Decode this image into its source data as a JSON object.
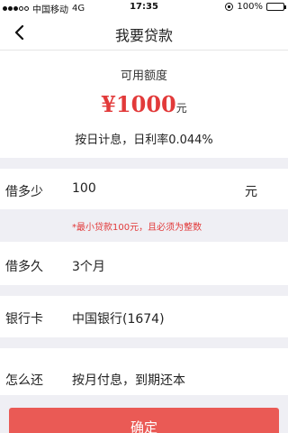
{
  "status_bar": {
    "carrier": "中国移动",
    "network": "4G",
    "time": "17:35",
    "battery_pct": "100%",
    "battery_level": 1.0
  },
  "nav": {
    "title": "我要贷款",
    "back_icon": "chevron-left-icon"
  },
  "quota": {
    "label": "可用额度",
    "amount": "¥1000",
    "unit": "元",
    "rate_text": "按日计息，日利率0.044%"
  },
  "form": {
    "amount": {
      "label": "借多少",
      "value": "100",
      "unit": "元"
    },
    "hint": "*最小贷款100元，且必须为整数",
    "term": {
      "label": "借多久",
      "value": "3个月"
    },
    "card": {
      "label": "银行卡",
      "value": "中国银行(1674)"
    },
    "repay": {
      "label": "怎么还",
      "value": "按月付息，到期还本"
    }
  },
  "confirm_label": "确定",
  "colors": {
    "accent": "#e23a3a",
    "button": "#ea5a55",
    "background": "#efeff4"
  }
}
